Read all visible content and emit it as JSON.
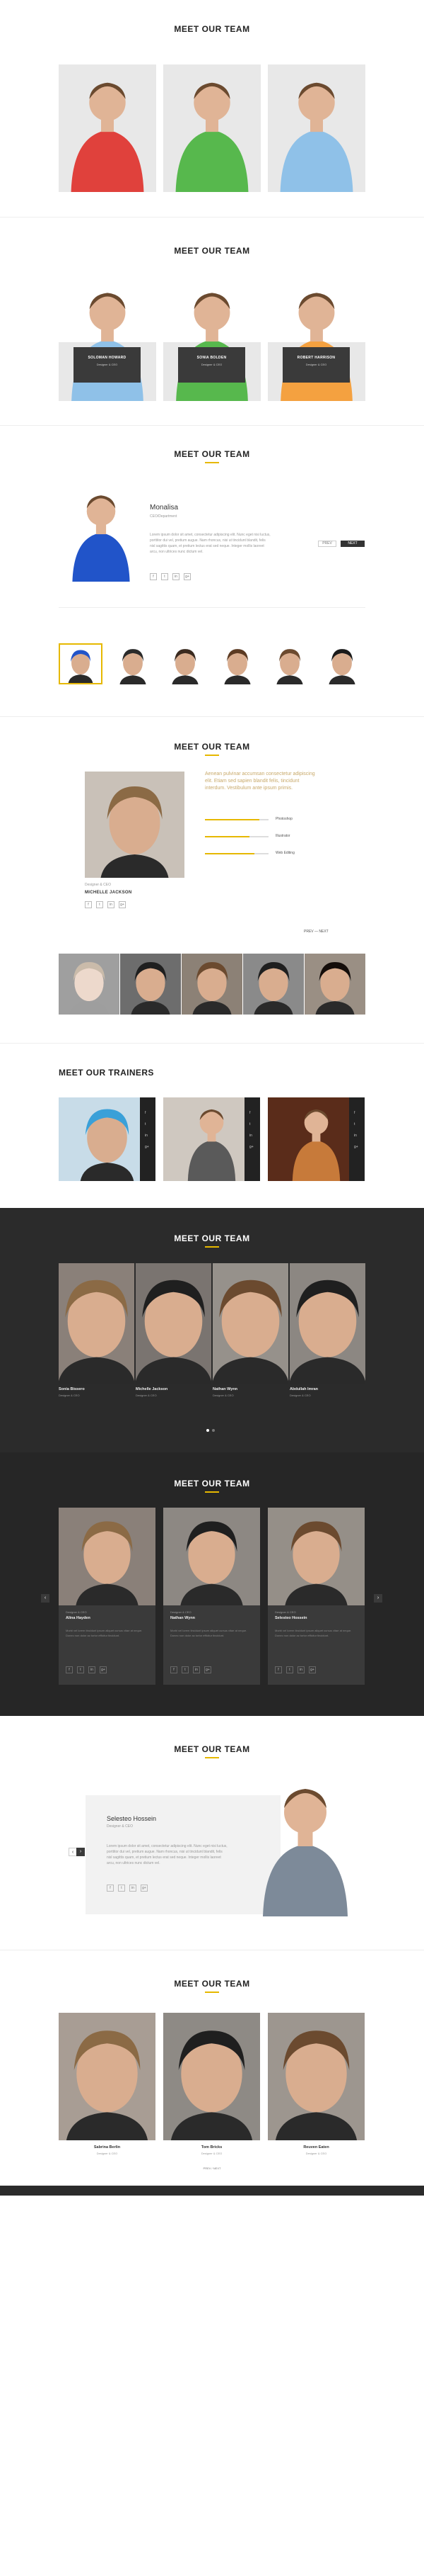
{
  "s1": {
    "title": "MEET OUR TEAM"
  },
  "s2": {
    "title": "MEET OUR TEAM",
    "members": [
      {
        "name": "SOLOMAN HOWARD",
        "role": "Designer & CEO"
      },
      {
        "name": "SONIA BOLDEN",
        "role": "Designer & CEO"
      },
      {
        "name": "ROBERT HARRISON",
        "role": "Designer & CEO"
      }
    ]
  },
  "s3": {
    "title": "MEET OUR TEAM",
    "name": "Monalisa",
    "role": "CEO/Department",
    "text1": "Lorem ipsum dolor sit amet, consectetur adipiscing elit. Nunc eget nisi luctus,",
    "text2": "porttitor dui vel, pretium augue. Nam rhoncus, nisi ut tincidunt blandit, felis",
    "text3": "nisl sagittis quam, et pretium lectus erat sed neque. Integer mollis laoreet",
    "text4": "arcu, non ultrices nunc dictum vel.",
    "prev": "PREV",
    "next": "NEXT",
    "social": [
      "f",
      "t",
      "in",
      "g+"
    ]
  },
  "s4": {
    "title": "MEET OUR TEAM",
    "role_small": "Designer & CEO",
    "name": "MICHELLE JACKSON",
    "desc1": "Aenean pulvinar accumsan consectetur adipiscing",
    "desc2": "elit. Etiam sed sapien blandit felis, tincidunt",
    "desc3": "interdum. Vestibulum ante ipsum primis.",
    "skills": [
      {
        "label": "Photoshop",
        "level": 0.85
      },
      {
        "label": "Illustrator",
        "level": 0.7
      },
      {
        "label": "Web Editing",
        "level": 0.78
      }
    ],
    "prev": "PREV",
    "next": "NEXT",
    "social": [
      "f",
      "t",
      "in",
      "g+"
    ]
  },
  "s5": {
    "title": "MEET OUR TRAINERS",
    "social": [
      "f",
      "t",
      "in",
      "g+"
    ]
  },
  "s6": {
    "title": "MEET OUR TEAM",
    "members": [
      {
        "name": "Sonia Bissero",
        "role": "Designer & CEO"
      },
      {
        "name": "Michelle Jackson",
        "role": "Designer & CEO"
      },
      {
        "name": "Nathan Wynn",
        "role": "Designer & CEO"
      },
      {
        "name": "Abdullah Imran",
        "role": "Designer & CEO"
      }
    ]
  },
  "s7": {
    "title": "MEET OUR TEAM",
    "members": [
      {
        "role": "Designer & CEO",
        "name": "Alina Hayden"
      },
      {
        "role": "Designer & CEO",
        "name": "Nathan Wynn"
      },
      {
        "role": "Designer & CEO",
        "name": "Selesteo Hossein"
      }
    ],
    "body": "Morbi vel lorem tincidunt ipsum aliquet cursus vitae at neque. Donec non dolor ac tortor efficitur tincidunt."
  },
  "s8": {
    "title": "MEET OUR TEAM",
    "name": "Selesteo Hossein",
    "role": "Designer & CEO",
    "text1": "Lorem ipsum dolor sit amet, consectetur adipiscing elit. Nunc eget nisi luctus,",
    "text2": "porttitor dui vel, pretium augue. Nam rhoncus, nisi ut tincidunt blandit, felis",
    "text3": "nisl sagittis quam, et pretium lectus erat sed neque. Integer mollis laoreet",
    "text4": "arcu, non ultrices nunc dictum vel."
  },
  "s9": {
    "title": "MEET OUR TEAM",
    "members": [
      {
        "name": "Sabrina Berlin",
        "role": "Designer & CEO"
      },
      {
        "name": "Tom Bricks",
        "role": "Designer & CEO"
      },
      {
        "name": "Reuven Eaten",
        "role": "Designer & CEO"
      }
    ],
    "pager": "PREV  /  NEXT"
  }
}
